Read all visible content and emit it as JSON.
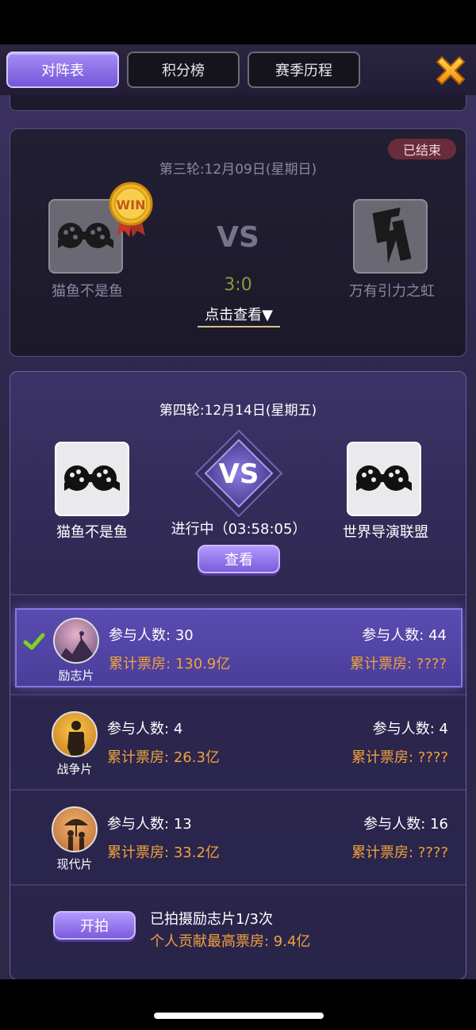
{
  "tabs": [
    {
      "label": "对阵表",
      "active": true
    },
    {
      "label": "积分榜",
      "active": false
    },
    {
      "label": "赛季历程",
      "active": false
    }
  ],
  "close_icon": "close-x-icon",
  "match_prev": {
    "status_badge": "已结束",
    "round_title": "第三轮:12月09日(星期日)",
    "team_left": {
      "name": "猫鱼不是鱼",
      "logo": "film-reel-icon"
    },
    "team_right": {
      "name": "万有引力之虹",
      "logo": "lightning-film-icon"
    },
    "winner_badge": "WIN",
    "vs": "VS",
    "score": "3:0",
    "view_link": "点击查看▼"
  },
  "match_current": {
    "round_title": "第四轮:12月14日(星期五)",
    "team_left": {
      "name": "猫鱼不是鱼",
      "logo": "film-reel-icon"
    },
    "team_right": {
      "name": "世界导演联盟",
      "logo": "film-reel-icon"
    },
    "vs": "VS",
    "status": "进行中（03:58:05）",
    "check_button": "查看"
  },
  "genres": [
    {
      "label": "励志片",
      "selected": true,
      "left_participants_label": "参与人数:",
      "left_participants": "30",
      "left_box_label": "累计票房:",
      "left_box": "130.9亿",
      "right_participants_label": "参与人数:",
      "right_participants": "44",
      "right_box_label": "累计票房:",
      "right_box": "????"
    },
    {
      "label": "战争片",
      "selected": false,
      "left_participants_label": "参与人数:",
      "left_participants": "4",
      "left_box_label": "累计票房:",
      "left_box": "26.3亿",
      "right_participants_label": "参与人数:",
      "right_participants": "4",
      "right_box_label": "累计票房:",
      "right_box": "????"
    },
    {
      "label": "现代片",
      "selected": false,
      "left_participants_label": "参与人数:",
      "left_participants": "13",
      "left_box_label": "累计票房:",
      "left_box": "33.2亿",
      "right_participants_label": "参与人数:",
      "right_participants": "16",
      "right_box_label": "累计票房:",
      "right_box": "????"
    }
  ],
  "footer": {
    "start_button": "开拍",
    "filmed_text": "已拍摄励志片1/3次",
    "contrib_text": "个人贡献最高票房: 9.4亿"
  },
  "colors": {
    "accent_purple": "#7b5bdc",
    "box_office_orange": "#f0a23a",
    "ended_badge": "#6a2c3a",
    "score_green": "#8a9a3c"
  }
}
